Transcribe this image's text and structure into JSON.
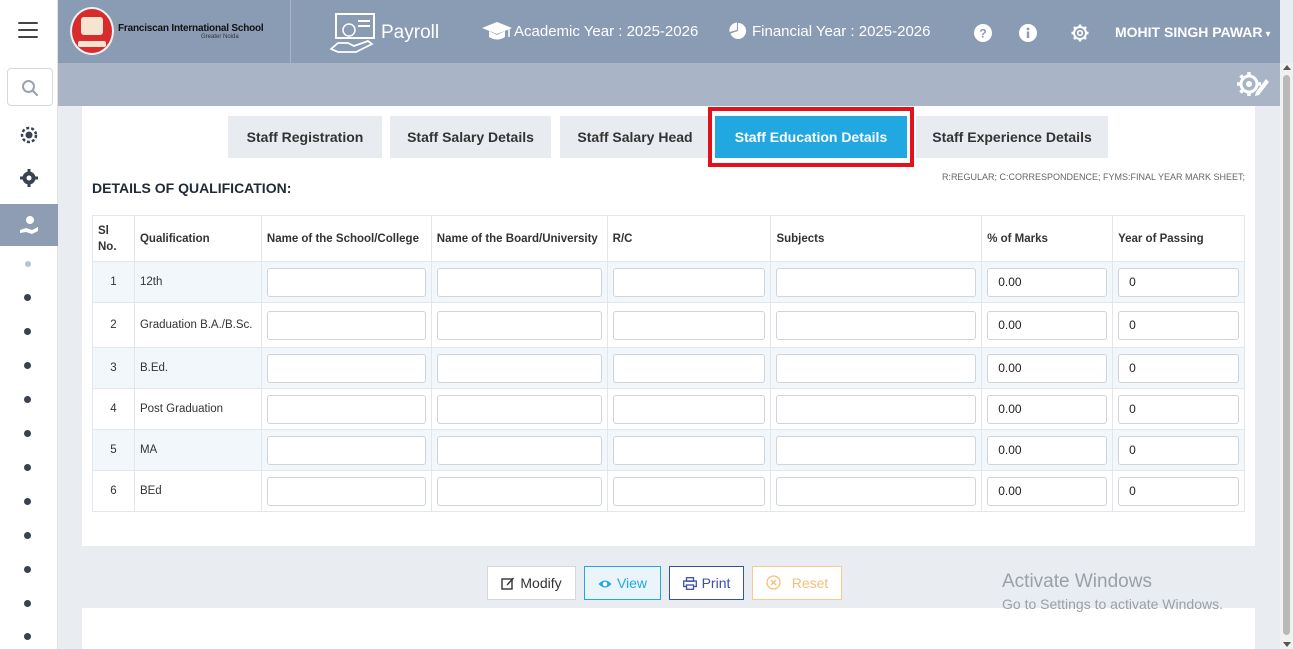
{
  "header": {
    "school_name": "Franciscan International School",
    "school_location": "Greater Noida",
    "module": "Payroll",
    "academic_year": "Academic Year : 2025-2026",
    "financial_year": "Financial Year : 2025-2026",
    "user_name": "MOHIT SINGH PAWAR",
    "brand_color": "#8a9bb4"
  },
  "tabs": [
    {
      "label": "Staff Registration"
    },
    {
      "label": "Staff Salary Details"
    },
    {
      "label": "Staff Salary Head"
    },
    {
      "label": "Staff Education Details"
    },
    {
      "label": "Staff Experience Details"
    }
  ],
  "active_tab": "Staff Education Details",
  "section": {
    "title": "DETAILS OF QUALIFICATION:",
    "legend": "R:REGULAR; C:CORRESPONDENCE; FYMS:FINAL YEAR MARK SHEET;"
  },
  "table": {
    "headers": {
      "sl": "Sl No.",
      "qualification": "Qualification",
      "school": "Name of the School/College",
      "board": "Name of the Board/University",
      "rc": "R/C",
      "subjects": "Subjects",
      "marks": "% of Marks",
      "year": "Year of Passing"
    },
    "rows": [
      {
        "sl": "1",
        "qualification": "12th",
        "school": "",
        "board": "",
        "rc": "",
        "subjects": "",
        "marks": "0.00",
        "year": "0"
      },
      {
        "sl": "2",
        "qualification": "Graduation B.A./B.Sc.",
        "school": "",
        "board": "",
        "rc": "",
        "subjects": "",
        "marks": "0.00",
        "year": "0"
      },
      {
        "sl": "3",
        "qualification": "B.Ed.",
        "school": "",
        "board": "",
        "rc": "",
        "subjects": "",
        "marks": "0.00",
        "year": "0"
      },
      {
        "sl": "4",
        "qualification": "Post Graduation",
        "school": "",
        "board": "",
        "rc": "",
        "subjects": "",
        "marks": "0.00",
        "year": "0"
      },
      {
        "sl": "5",
        "qualification": "MA",
        "school": "",
        "board": "",
        "rc": "",
        "subjects": "",
        "marks": "0.00",
        "year": "0"
      },
      {
        "sl": "6",
        "qualification": "BEd",
        "school": "",
        "board": "",
        "rc": "",
        "subjects": "",
        "marks": "0.00",
        "year": "0"
      }
    ]
  },
  "buttons": {
    "modify": "Modify",
    "view": "View",
    "print": "Print",
    "reset": "Reset"
  },
  "watermark": {
    "line1": "Activate Windows",
    "line2": "Go to Settings to activate Windows."
  }
}
